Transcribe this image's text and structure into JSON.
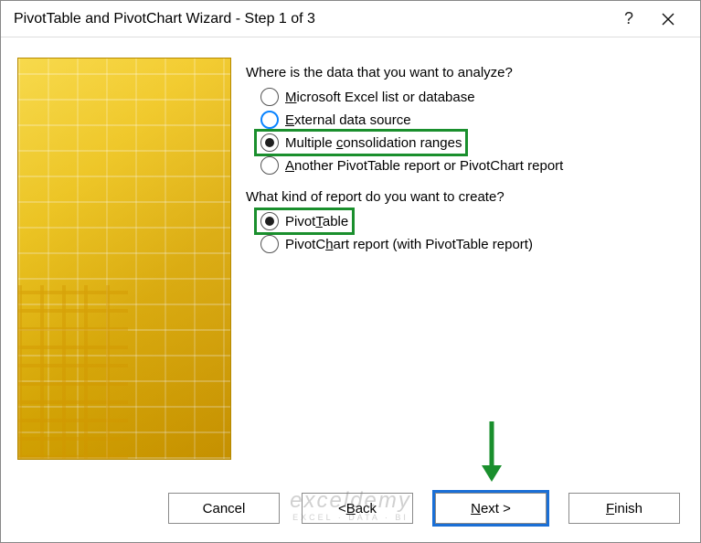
{
  "titlebar": {
    "title": "PivotTable and PivotChart Wizard - Step 1 of 3"
  },
  "group1": {
    "label": "Where is the data that you want to analyze?",
    "options": {
      "excel": {
        "pre": "",
        "key": "M",
        "post": "icrosoft Excel list or database"
      },
      "external": {
        "pre": "",
        "key": "E",
        "post": "xternal data source"
      },
      "multi": {
        "pre": "Multiple ",
        "key": "c",
        "post": "onsolidation ranges"
      },
      "another": {
        "pre": "",
        "key": "A",
        "post": "nother PivotTable report or PivotChart report"
      }
    }
  },
  "group2": {
    "label": "What kind of report do you want to create?",
    "options": {
      "table": {
        "pre": "Pivot",
        "key": "T",
        "post": "able"
      },
      "chart": {
        "pre": "PivotC",
        "key": "h",
        "post": "art report (with PivotTable report)"
      }
    }
  },
  "buttons": {
    "cancel": "Cancel",
    "back": {
      "pre": "< ",
      "key": "B",
      "post": "ack"
    },
    "next": {
      "pre": "",
      "key": "N",
      "post": "ext >"
    },
    "finish": {
      "pre": "",
      "key": "F",
      "post": "inish"
    }
  },
  "watermark": {
    "main": "exceldemy",
    "sub": "EXCEL · DATA · BI"
  }
}
